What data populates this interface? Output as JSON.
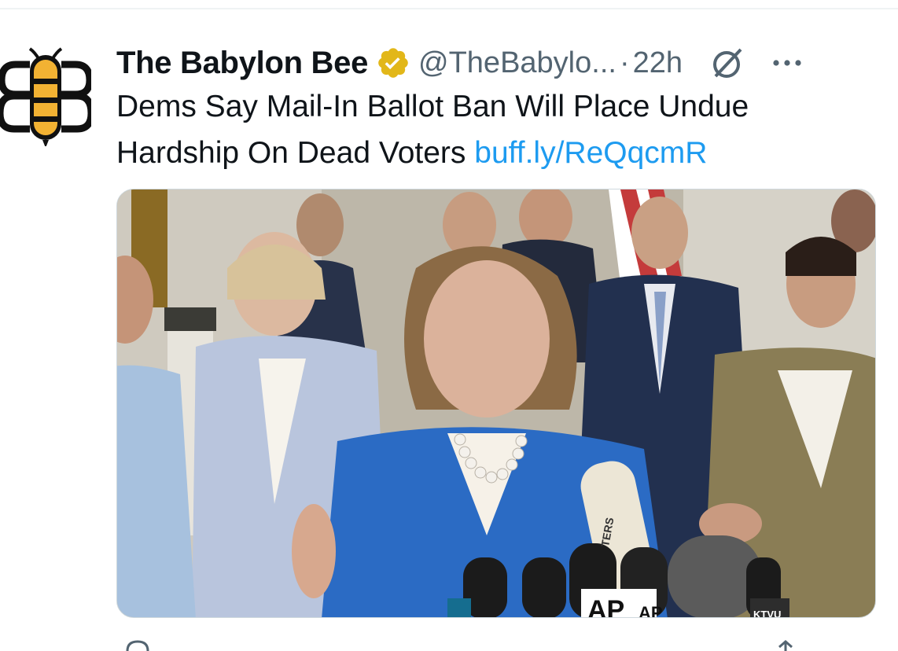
{
  "tweet": {
    "author": {
      "display_name": "The Babylon Bee",
      "handle": "@TheBabylo...",
      "verified": true,
      "avatar_icon": "babylon-bee-logo"
    },
    "separator": "·",
    "time": "22h",
    "text": "Dems Say Mail-In Ballot Ban Will Place Undue Hardship On Dead Voters",
    "link": "buff.ly/ReQqcmR",
    "media": {
      "type": "photo",
      "mic_labels": [
        "AP",
        "AP",
        "KTVU",
        "TERS"
      ]
    },
    "icons": {
      "verified": "verified-badge-icon",
      "grok": "grok-icon",
      "more": "more-options-icon"
    }
  },
  "colors": {
    "link": "#1d9bf0",
    "secondary_text": "#536471",
    "verified_gold": "#e2b719",
    "bee_yellow": "#f2b233",
    "suit_blue": "#2b6bc4"
  }
}
